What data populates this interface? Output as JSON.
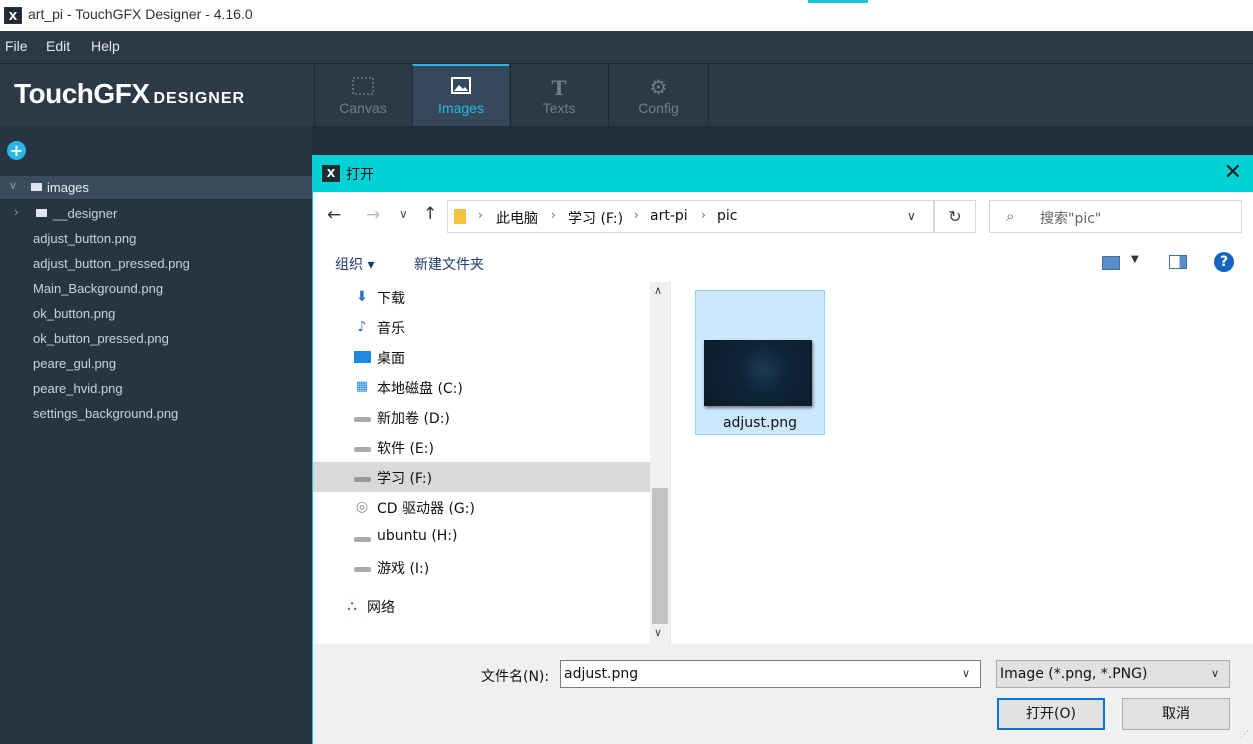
{
  "window": {
    "title": "art_pi - TouchGFX Designer - 4.16.0",
    "icon_glyph": "X"
  },
  "menu": [
    "File",
    "Edit",
    "Help"
  ],
  "logo": {
    "main": "TouchGFX",
    "sub": "DESIGNER"
  },
  "tabs": [
    {
      "label": "Canvas",
      "icon": "canvas-icon",
      "active": false
    },
    {
      "label": "Images",
      "icon": "image-icon",
      "active": true
    },
    {
      "label": "Texts",
      "icon": "text-icon",
      "active": false
    },
    {
      "label": "Config",
      "icon": "gear-icon",
      "active": false
    }
  ],
  "left": {
    "root": "images",
    "folder": "__designer",
    "files": [
      "adjust_button.png",
      "adjust_button_pressed.png",
      "Main_Background.png",
      "ok_button.png",
      "ok_button_pressed.png",
      "peare_gul.png",
      "peare_hvid.png",
      "settings_background.png"
    ]
  },
  "dialog": {
    "title": "打开",
    "breadcrumb": [
      "此电脑",
      "学习 (F:)",
      "art-pi",
      "pic"
    ],
    "search_placeholder": "搜索\"pic\"",
    "toolbar": {
      "organize": "组织 ▾",
      "new_folder": "新建文件夹"
    },
    "nav_items": [
      {
        "label": "下载",
        "icon": "download-icon"
      },
      {
        "label": "音乐",
        "icon": "music-icon"
      },
      {
        "label": "桌面",
        "icon": "desktop-icon"
      },
      {
        "label": "本地磁盘 (C:)",
        "icon": "windows-drive-icon"
      },
      {
        "label": "新加卷 (D:)",
        "icon": "drive-icon"
      },
      {
        "label": "软件 (E:)",
        "icon": "drive-icon"
      },
      {
        "label": "学习 (F:)",
        "icon": "drive-icon",
        "selected": true
      },
      {
        "label": "CD 驱动器 (G:)",
        "icon": "cd-drive-icon"
      },
      {
        "label": "ubuntu (H:)",
        "icon": "drive-icon"
      },
      {
        "label": "游戏 (I:)",
        "icon": "drive-icon"
      },
      {
        "label": "网络",
        "icon": "network-icon"
      }
    ],
    "file": {
      "name": "adjust.png"
    },
    "filename_label": "文件名(N):",
    "filename_value": "adjust.png",
    "filter_value": "Image (*.png, *.PNG)",
    "open_label": "打开(O)",
    "cancel_label": "取消"
  },
  "colors": {
    "accent": "#29b6e8",
    "dialog_title": "#00d2d6",
    "panel": "#263541"
  }
}
